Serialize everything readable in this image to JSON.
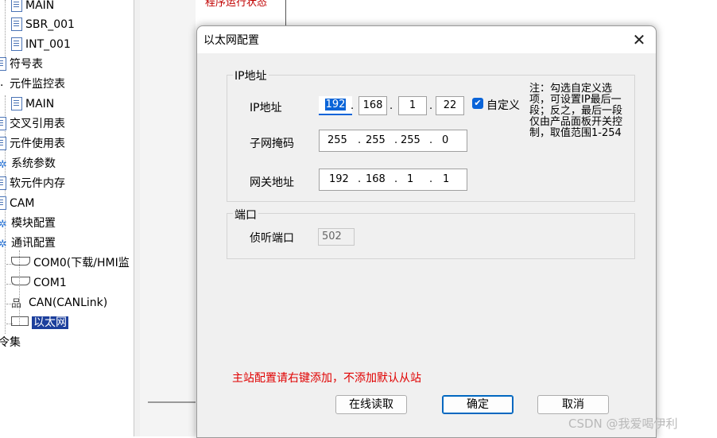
{
  "tree": {
    "items": [
      {
        "label": "MAIN"
      },
      {
        "label": "SBR_001"
      },
      {
        "label": "INT_001"
      },
      {
        "label": "符号表"
      },
      {
        "label": "元件监控表"
      },
      {
        "label": "MAIN"
      },
      {
        "label": "交叉引用表"
      },
      {
        "label": "元件使用表"
      },
      {
        "label": "系统参数"
      },
      {
        "label": "软元件内存"
      },
      {
        "label": "CAM"
      },
      {
        "label": "模块配置"
      },
      {
        "label": "通讯配置"
      },
      {
        "label": "COM0(下载/HMI监"
      },
      {
        "label": "COM1"
      },
      {
        "label": "CAN(CANLink)"
      },
      {
        "label": "以太网"
      },
      {
        "label": "令集"
      }
    ]
  },
  "background": {
    "tab_label": "程序运行状态"
  },
  "dialog": {
    "title": "以太网配置",
    "close_glyph": "✕",
    "ip_group_label": "IP地址",
    "ip_label": "IP地址",
    "ip": [
      "192",
      "168",
      "1",
      "22"
    ],
    "custom_label": "自定义",
    "custom_checked": true,
    "note": "注：勾选自定义选项，可设置IP最后一段；反之，最后一段仅由产品面板开关控制，取值范围1-254",
    "mask_label": "子网掩码",
    "mask": [
      "255",
      "255",
      "255",
      "0"
    ],
    "gateway_label": "网关地址",
    "gateway": [
      "192",
      "168",
      "1",
      "1"
    ],
    "port_group_label": "端口",
    "listen_port_label": "侦听端口",
    "listen_port": "502",
    "warning": "主站配置请右键添加，不添加默认从站",
    "buttons": {
      "online_read": "在线读取",
      "ok": "确定",
      "cancel": "取消"
    }
  },
  "watermark": "CSDN @我爱喝伊利",
  "colors": {
    "selection": "#1c3f9c",
    "warning": "#e00000",
    "accent": "#0067c0"
  }
}
